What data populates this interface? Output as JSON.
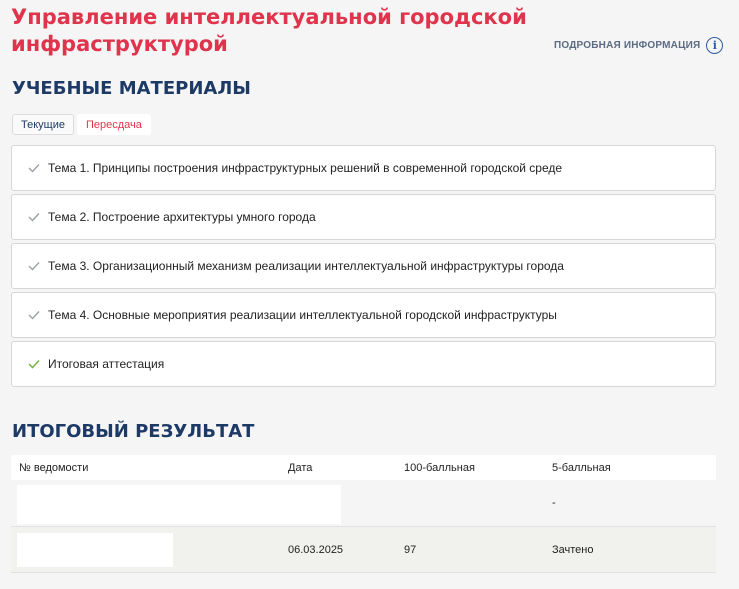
{
  "header": {
    "title": "Управление интеллектуальной городской инфраструктурой",
    "info_label": "ПОДРОБНАЯ ИНФОРМАЦИЯ",
    "info_icon": "info-circle-icon",
    "title_color": "#e0334c"
  },
  "materials": {
    "title": "УЧЕБНЫЕ МАТЕРИАЛЫ",
    "tabs": [
      {
        "label": "Текущие"
      },
      {
        "label": "Пересдача"
      }
    ],
    "topics": [
      {
        "label": "Тема 1. Принципы построения инфраструктурных решений в современной городской среде",
        "check_color": "#9aa0a6"
      },
      {
        "label": "Тема 2. Построение архитектуры умного города",
        "check_color": "#9aa0a6"
      },
      {
        "label": "Тема 3. Организационный механизм реализации интеллектуальной инфраструктуры города",
        "check_color": "#9aa0a6"
      },
      {
        "label": "Тема 4. Основные мероприятия реализации интеллектуальной городской инфраструктуры",
        "check_color": "#9aa0a6"
      },
      {
        "label": "Итоговая аттестация",
        "check_color": "#7cb342"
      }
    ]
  },
  "result": {
    "title": "ИТОГОВЫЙ РЕЗУЛЬТАТ",
    "columns": [
      "№ ведомости",
      "Дата",
      "100-балльная",
      "5-балльная"
    ],
    "rows": [
      {
        "sheet": "",
        "date": "",
        "score100": "",
        "score5": "-"
      },
      {
        "sheet": "",
        "date": "06.03.2025",
        "score100": "97",
        "score5": "Зачтено"
      }
    ]
  }
}
